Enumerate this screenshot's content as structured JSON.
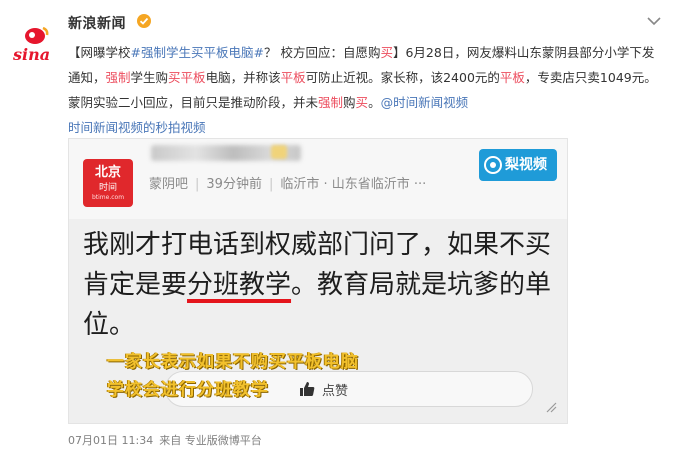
{
  "account": {
    "name": "新浪新闻",
    "logo_text": "sina"
  },
  "post": {
    "seg1": "【网曝学校",
    "seg2": "#强制学生买平板电脑#",
    "seg3": "？ 校方回应：自愿购",
    "seg4": "买",
    "seg5": "】6月28日，网友爆料山东蒙阴县部分小学下发通知，",
    "seg6": "强制",
    "seg7": "学生购",
    "seg8": "买平板",
    "seg9": "电脑，并称该",
    "seg10": "平板",
    "seg11": "可防止近视。家长称，该2400元的",
    "seg12": "平板",
    "seg13": "，专卖店只卖1049元。蒙阴实验二小回应，目前只是推动阶段，并未",
    "seg14": "强制",
    "seg15": "购",
    "seg16": "买",
    "seg17": "。",
    "seg18": "@时间新闻视频",
    "seg19": "时间新闻视频的秒拍视频"
  },
  "media": {
    "logo_line1": "北京",
    "logo_line2": "时间",
    "logo_line3": "btime.com",
    "forum": "蒙阴吧",
    "time_ago": "39分钟前",
    "location1": "临沂市 · 山东省临沂市 ···",
    "watermark": "梨视频",
    "big_before": "我刚才打电话到权威部门问了，如果不买肯定是要",
    "big_underlined": "分班教学",
    "big_after": "。教育局就是坑爹的单位。",
    "caption1": "一家长表示如果不购买平板电脑",
    "caption2": "学校会进行分班教学",
    "like_label": "点赞"
  },
  "footer": {
    "time": "07月01日 11:34",
    "source": "来自 专业版微博平台"
  }
}
